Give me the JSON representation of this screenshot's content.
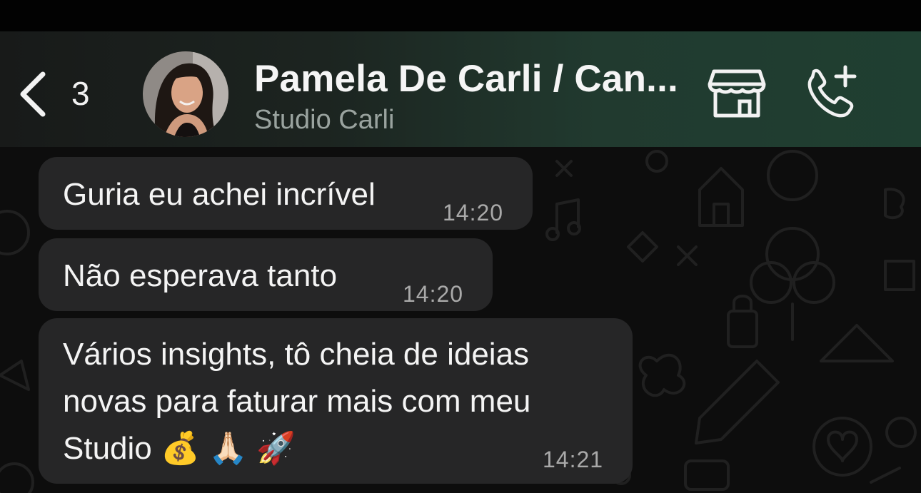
{
  "header": {
    "back_count": "3",
    "contact_name": "Pamela De Carli / Can...",
    "contact_subtitle": "Studio Carli",
    "icons": {
      "back": "chevron-left-icon",
      "store": "storefront-icon",
      "call": "add-call-icon"
    }
  },
  "messages": [
    {
      "text": "Guria eu achei incrível",
      "time": "14:20"
    },
    {
      "text": "Não esperava tanto",
      "time": "14:20"
    },
    {
      "text": "Vários insights, tô cheia de ideias\nnovas para faturar mais com meu\nStudio 💰 🙏🏻 🚀",
      "time": "14:21"
    }
  ],
  "colors": {
    "header_gradient_end": "#1f3f31",
    "bubble_background": "#262627",
    "chat_background": "#0d0d0d",
    "timestamp": "#a9a9a9",
    "subtitle": "#9aa39f"
  }
}
